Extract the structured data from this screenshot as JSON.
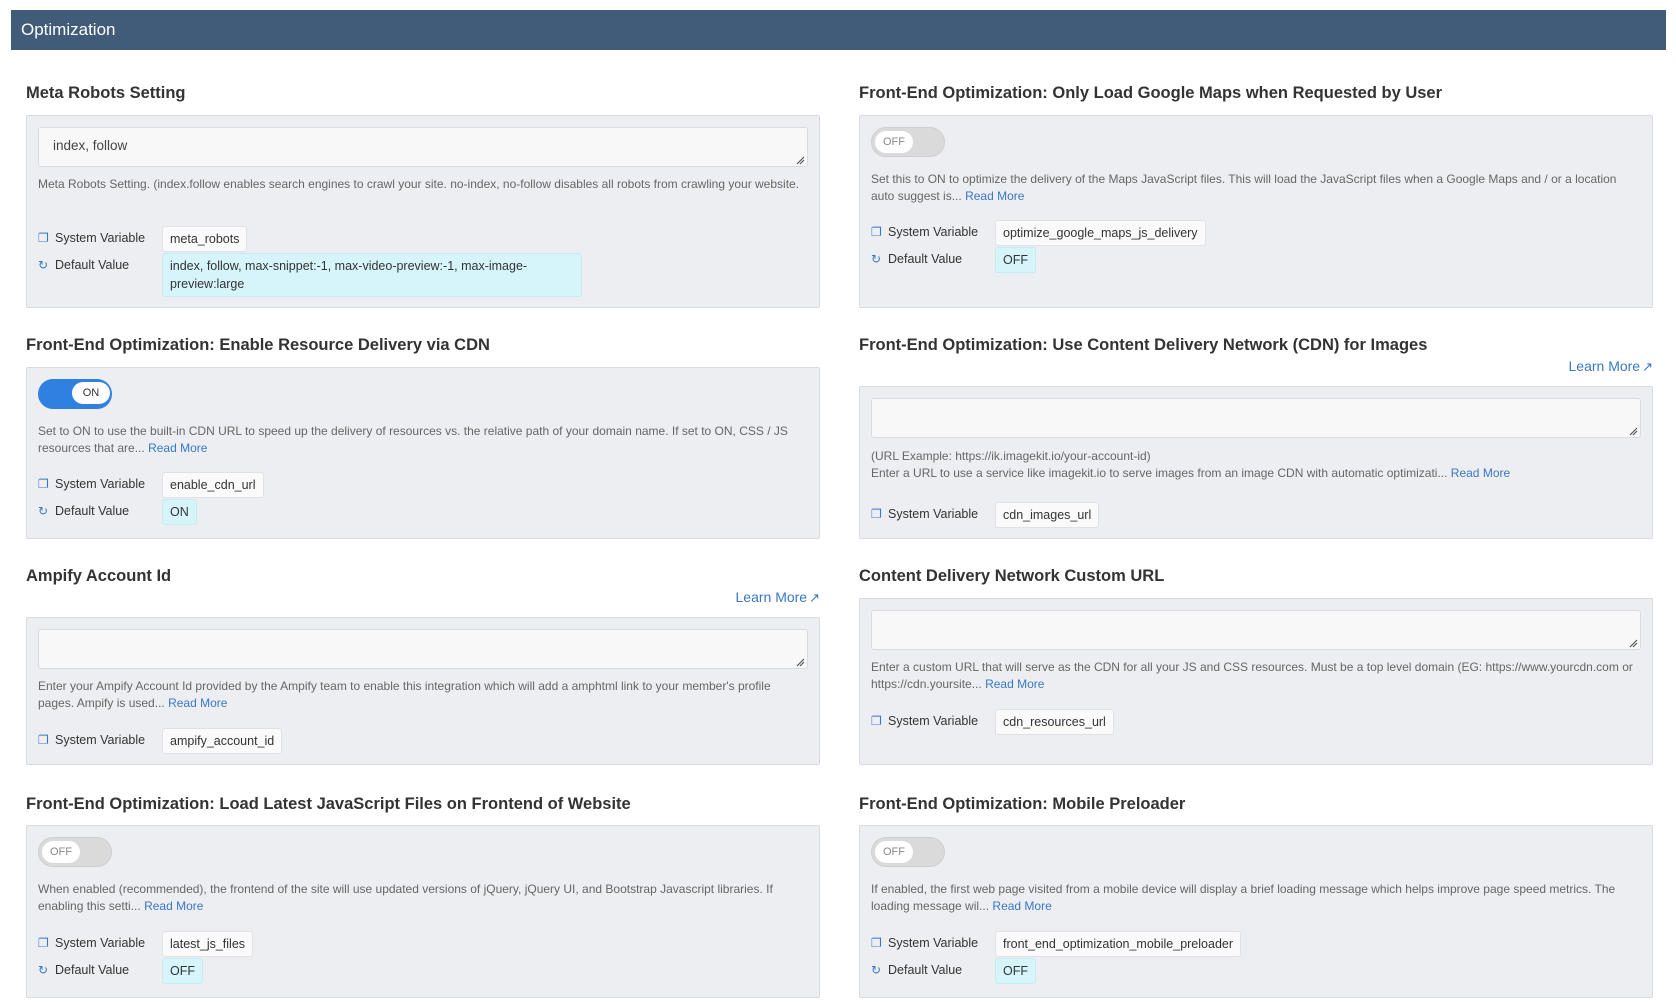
{
  "header": {
    "title": "Optimization"
  },
  "common": {
    "system_variable_label": "System Variable",
    "default_value_label": "Default Value",
    "read_more": "Read More",
    "learn_more": "Learn More"
  },
  "meta_robots": {
    "title": "Meta Robots Setting",
    "value": "index, follow",
    "description": "Meta Robots Setting. (index.follow enables search engines to crawl your site. no-index, no-follow disables all robots from crawling your website.",
    "system_variable": "meta_robots",
    "default_value": "index, follow, max-snippet:-1, max-video-preview:-1, max-image-preview:large"
  },
  "google_maps": {
    "title": "Front-End Optimization: Only Load Google Maps when Requested by User",
    "toggle": "OFF",
    "description": "Set this to ON to optimize the delivery of the Maps JavaScript files. This will load the JavaScript files when a Google Maps and / or a location auto suggest is...",
    "system_variable": "optimize_google_maps_js_delivery",
    "default_value": "OFF"
  },
  "cdn_resources": {
    "title": "Front-End Optimization: Enable Resource Delivery via CDN",
    "toggle": "ON",
    "description": "Set to ON to use the built-in CDN URL to speed up the delivery of resources vs. the relative path of your domain name. If set to ON, CSS / JS resources that are...",
    "system_variable": "enable_cdn_url",
    "default_value": "ON"
  },
  "cdn_images": {
    "title": "Front-End Optimization: Use Content Delivery Network (CDN) for Images",
    "value": "",
    "example": "(URL Example: https://ik.imagekit.io/your-account-id)",
    "description": "Enter a URL to use a service like imagekit.io to serve images from an image CDN with automatic optimizati...",
    "system_variable": "cdn_images_url"
  },
  "ampify": {
    "title": "Ampify Account Id",
    "value": "",
    "description": "Enter your Ampify Account Id provided by the Ampify team to enable this integration which will add a amphtml link to your member's profile pages. Ampify is used...",
    "system_variable": "ampify_account_id"
  },
  "cdn_custom": {
    "title": "Content Delivery Network Custom URL",
    "value": "",
    "description": "Enter a custom URL that will serve as the CDN for all your JS and CSS resources. Must be a top level domain (EG: https://www.yourcdn.com or https://cdn.yoursite...",
    "system_variable": "cdn_resources_url"
  },
  "latest_js": {
    "title": "Front-End Optimization: Load Latest JavaScript Files on Frontend of Website",
    "toggle": "OFF",
    "description": "When enabled (recommended), the frontend of the site will use updated versions of jQuery, jQuery UI, and Bootstrap Javascript libraries. If enabling this setti...",
    "system_variable": "latest_js_files",
    "default_value": "OFF"
  },
  "mobile_preloader": {
    "title": "Front-End Optimization: Mobile Preloader",
    "toggle": "OFF",
    "description": "If enabled, the first web page visited from a mobile device will display a brief loading message which helps improve page speed metrics. The loading message wil...",
    "system_variable": "front_end_optimization_mobile_preloader",
    "default_value": "OFF"
  }
}
